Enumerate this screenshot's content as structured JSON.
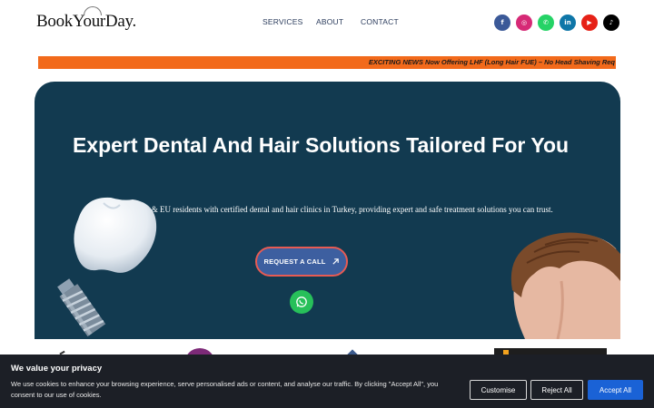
{
  "header": {
    "logo": "BookYourDay.",
    "nav": [
      "SERVICES",
      "ABOUT",
      "CONTACT"
    ],
    "social": [
      {
        "name": "facebook-icon",
        "glyph": "f",
        "color": "#3b5998"
      },
      {
        "name": "instagram-icon",
        "glyph": "◎",
        "color": "#d62976"
      },
      {
        "name": "whatsapp-icon",
        "glyph": "✆",
        "color": "#25d366"
      },
      {
        "name": "linkedin-icon",
        "glyph": "in",
        "color": "#0e76a8"
      },
      {
        "name": "youtube-icon",
        "glyph": "▶",
        "color": "#e62117"
      },
      {
        "name": "tiktok-icon",
        "glyph": "♪",
        "color": "#000000"
      }
    ]
  },
  "ticker": {
    "text": "EXCITING NEWS Now Offering LHF (Long Hair FUE) – No Head Shaving Req"
  },
  "hero": {
    "title": "Expert Dental And Hair Solutions Tailored For You",
    "description": "We connect UK & EU residents with certified dental and hair clinics in Turkey, providing expert and safe treatment solutions you can trust.",
    "cta_label": "REQUEST A CALL"
  },
  "cookie": {
    "title": "We value your privacy",
    "text": "We use cookies to enhance your browsing experience, serve personalised ads or content, and analyse our traffic. By clicking \"Accept All\", you consent to our use of cookies.",
    "customise": "Customise",
    "reject": "Reject All",
    "accept": "Accept All"
  },
  "colors": {
    "hero_bg": "#123a50",
    "ticker_bg": "#f26a1b",
    "cta_bg": "#3d5fa0",
    "cta_border": "#e85b53",
    "accept_bg": "#1a62d6"
  }
}
